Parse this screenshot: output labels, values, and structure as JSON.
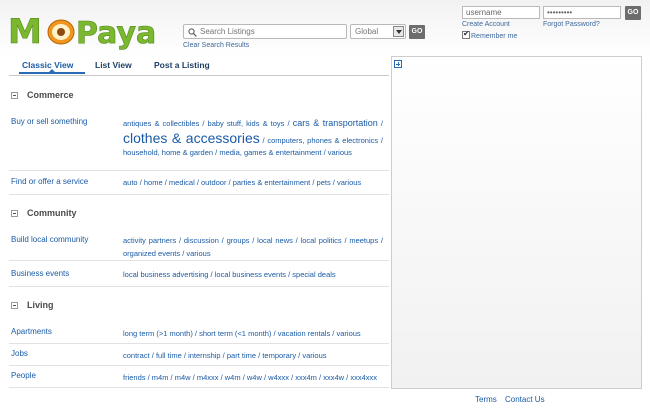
{
  "logo": {
    "text": "MoPaya"
  },
  "search": {
    "placeholder": "Search Listings",
    "scope": "Global",
    "go": "GO",
    "clear": "Clear Search Results"
  },
  "login": {
    "username": "username",
    "password": "•••••••••",
    "go": "GO",
    "create": "Create Account",
    "forgot": "Forgot Password?",
    "remember": "Remember me",
    "remember_checked": true
  },
  "tabs": [
    "Classic View",
    "List View",
    "Post a Listing"
  ],
  "sections": {
    "commerce": {
      "title": "Commerce"
    },
    "community": {
      "title": "Community"
    },
    "living": {
      "title": "Living"
    }
  },
  "rows": {
    "buy": {
      "label": "Buy or sell something",
      "links": [
        "antiques & collectibles",
        "baby stuff, kids & toys",
        "cars & transportation",
        "clothes & accessories",
        "computers, phones & electronics",
        "household, home & garden",
        "media, games & entertainment",
        "various"
      ]
    },
    "service": {
      "label": "Find or offer a service",
      "links": [
        "auto",
        "home",
        "medical",
        "outdoor",
        "parties & entertainment",
        "pets",
        "various"
      ]
    },
    "build": {
      "label": "Build local community",
      "links": [
        "activity partners",
        "discussion",
        "groups",
        "local news",
        "local politics",
        "meetups",
        "organized events",
        "various"
      ]
    },
    "events": {
      "label": "Business events",
      "links": [
        "local business advertising",
        "local business events",
        "special deals"
      ]
    },
    "apartments": {
      "label": "Apartments",
      "links": [
        "long term (>1 month)",
        "short term (<1 month)",
        "vacation rentals",
        "various"
      ]
    },
    "jobs": {
      "label": "Jobs",
      "links": [
        "contract",
        "full time",
        "internship",
        "part time",
        "temporary",
        "various"
      ]
    },
    "people": {
      "label": "People",
      "links": [
        "friends",
        "m4m",
        "m4w",
        "m4xxx",
        "w4m",
        "w4w",
        "w4xxx",
        "xxx4m",
        "xxx4w",
        "xxx4xxx"
      ]
    }
  },
  "footer": {
    "terms": "Terms",
    "contact": "Contact Us"
  },
  "colors": {
    "link": "#1a5ba6",
    "logo_green": "#7cb82f",
    "logo_orange": "#f0961e"
  }
}
